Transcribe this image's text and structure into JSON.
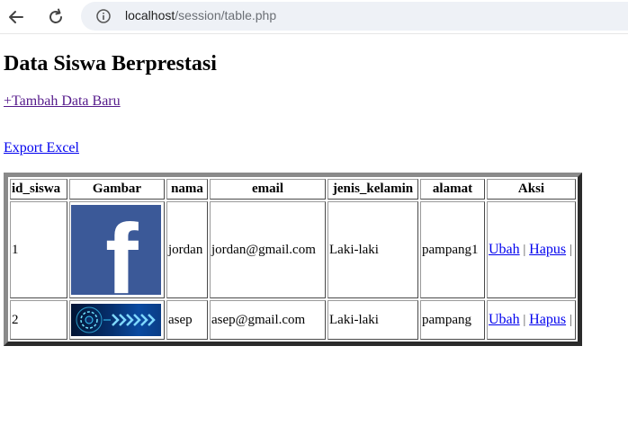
{
  "browser": {
    "url_host": "localhost",
    "url_path": "/session/table.php"
  },
  "page": {
    "title": "Data Siswa Berprestasi",
    "add_link": "+Tambah Data Baru",
    "export_link": "Export Excel"
  },
  "table": {
    "headers": [
      "id_siswa",
      "Gambar",
      "nama",
      "email",
      "jenis_kelamin",
      "alamat",
      "Aksi"
    ],
    "rows": [
      {
        "id": "1",
        "image": "facebook-logo",
        "nama": "jordan",
        "email": "jordan@gmail.com",
        "jenis_kelamin": "Laki-laki",
        "alamat": "pampang1",
        "edit": "Ubah",
        "delete": "Hapus",
        "sep1": "|",
        "sep2": "|"
      },
      {
        "id": "2",
        "image": "tech-banner",
        "nama": "asep",
        "email": "asep@gmail.com",
        "jenis_kelamin": "Laki-laki",
        "alamat": "pampang",
        "edit": "Ubah",
        "delete": "Hapus",
        "sep1": "|",
        "sep2": "|"
      }
    ]
  },
  "colors": {
    "link": "#0000ee",
    "visited_link": "#551a8b",
    "facebook_blue": "#3b5998"
  }
}
